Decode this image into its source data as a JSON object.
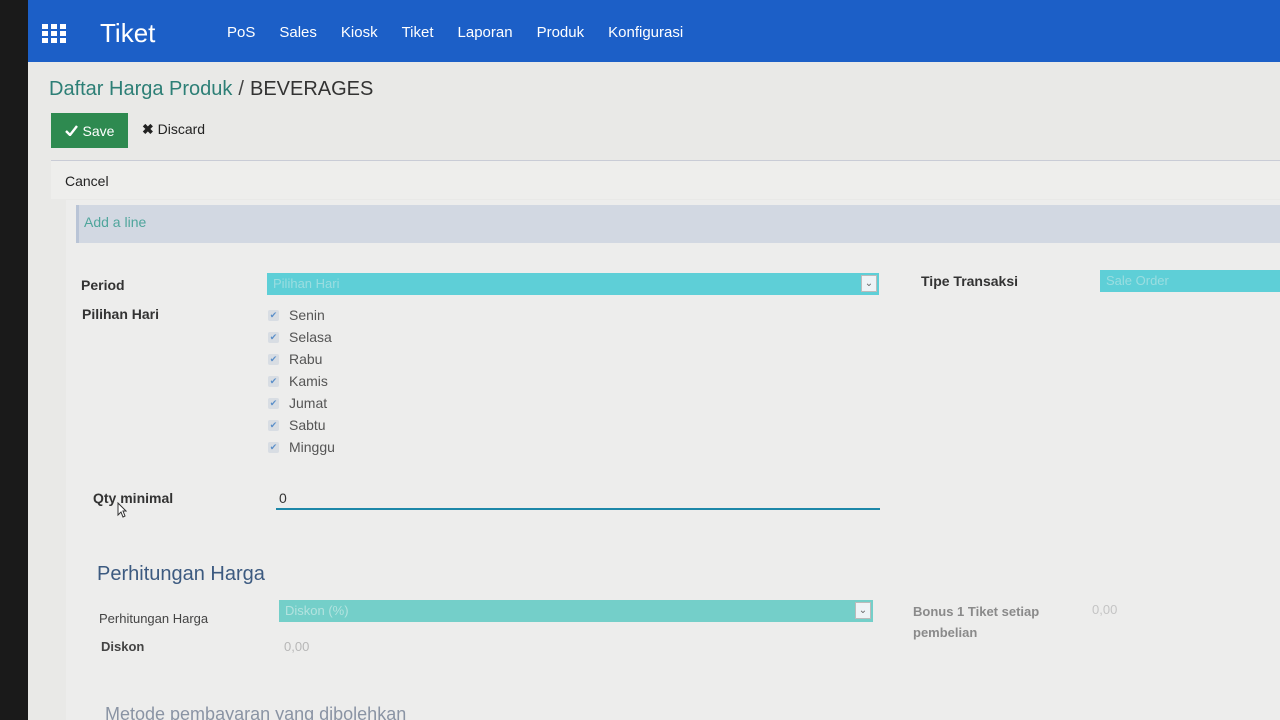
{
  "navbar": {
    "brand": "Tiket",
    "menu": [
      "PoS",
      "Sales",
      "Kiosk",
      "Tiket",
      "Laporan",
      "Produk",
      "Konfigurasi"
    ]
  },
  "breadcrumb": {
    "parent": "Daftar Harga Produk",
    "separator": "/",
    "current": "BEVERAGES"
  },
  "actions": {
    "save_label": "Save",
    "discard_label": "Discard",
    "cancel_label": "Cancel"
  },
  "lines": {
    "add_line_label": "Add a line"
  },
  "form": {
    "period_label": "Period",
    "period_value": "Pilihan Hari",
    "tipe_transaksi_label": "Tipe Transaksi",
    "tipe_transaksi_value": "Sale Order",
    "pilihan_hari_label": "Pilihan Hari",
    "days": [
      {
        "label": "Senin",
        "checked": true
      },
      {
        "label": "Selasa",
        "checked": true
      },
      {
        "label": "Rabu",
        "checked": true
      },
      {
        "label": "Kamis",
        "checked": true
      },
      {
        "label": "Jumat",
        "checked": true
      },
      {
        "label": "Sabtu",
        "checked": true
      },
      {
        "label": "Minggu",
        "checked": true
      }
    ],
    "qty_minimal_label": "Qty minimal",
    "qty_minimal_value": "0"
  },
  "pricing": {
    "section_title": "Perhitungan Harga",
    "perhitungan_label": "Perhitungan Harga",
    "perhitungan_value": "Diskon (%)",
    "diskon_label": "Diskon",
    "diskon_value": "0,00",
    "bonus_label": "Bonus 1 Tiket setiap pembelian",
    "bonus_value": "0,00"
  },
  "next_section": {
    "title": "Metode pembayaran yang dibolehkan"
  },
  "colors": {
    "navbar": "#1c5fc7",
    "save": "#2e8a50",
    "select_fill": "#5ecfd7",
    "link": "#2d7f76"
  }
}
